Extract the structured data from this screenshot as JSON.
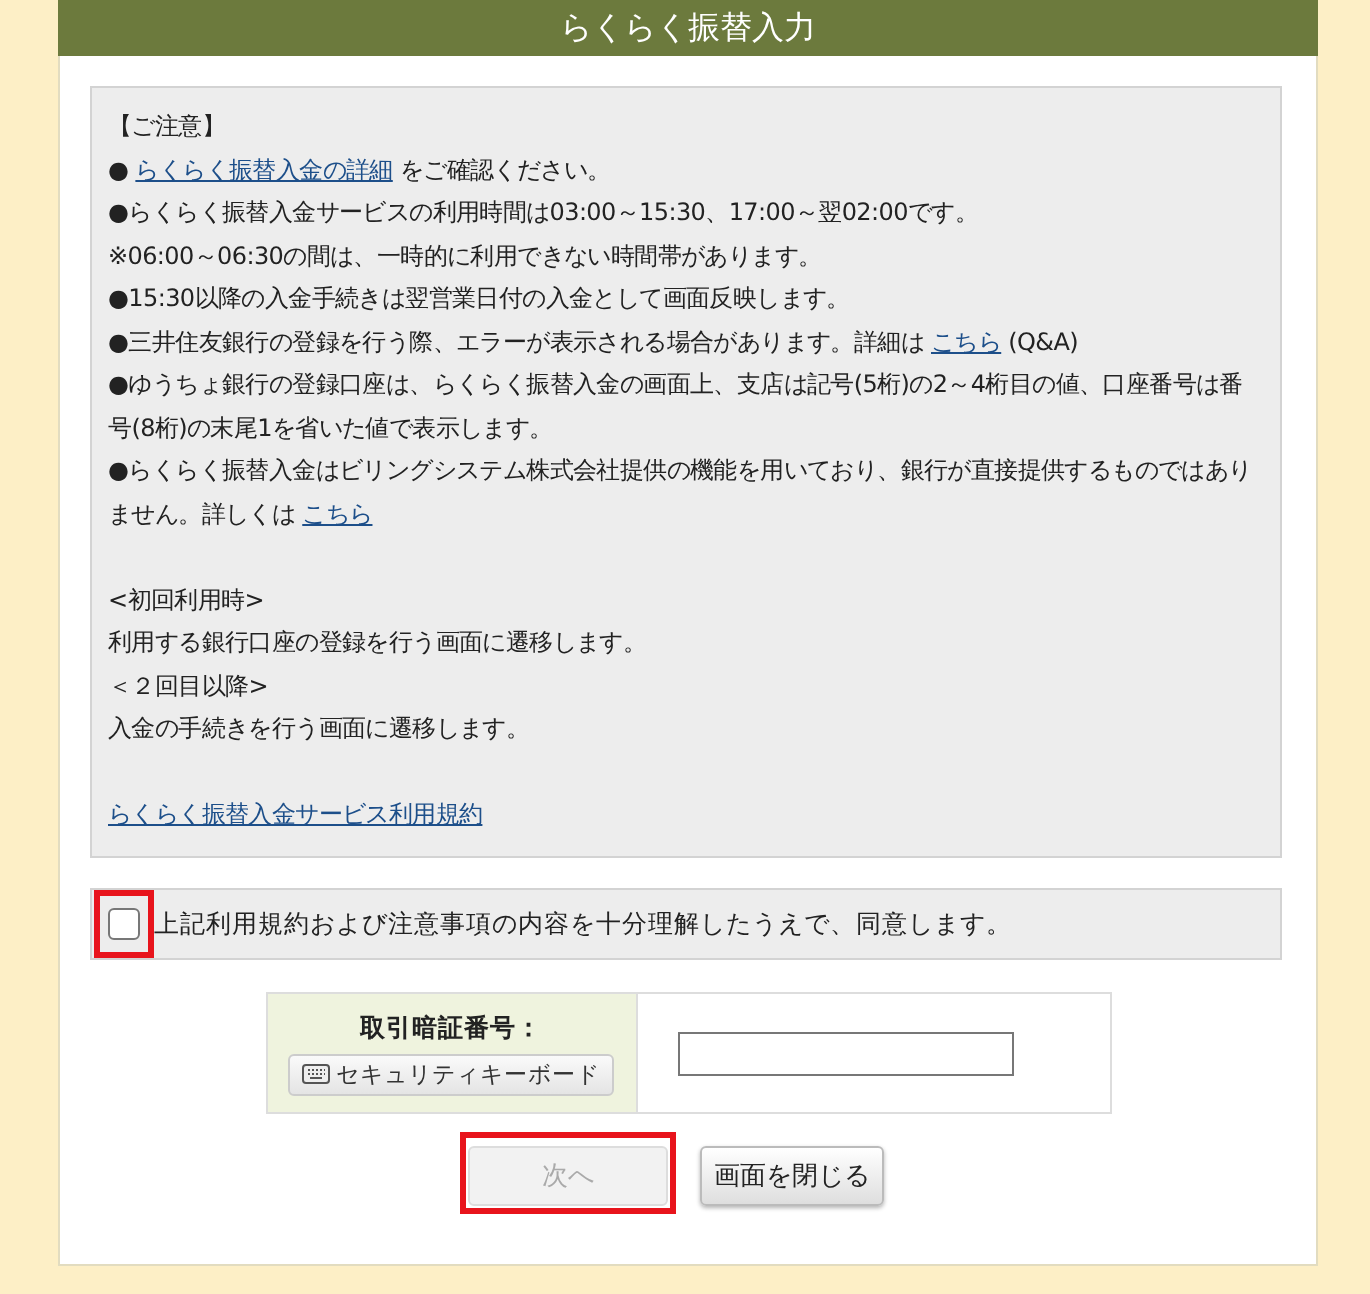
{
  "title": "らくらく振替入力",
  "notice_sections": [
    {
      "lines": [
        [
          {
            "kind": "text",
            "text": "【ご注意】"
          }
        ],
        [
          {
            "kind": "text",
            "text": "●"
          },
          {
            "kind": "link",
            "text": "らくらく振替入金の詳細"
          },
          {
            "kind": "text",
            "text": "をご確認ください。"
          }
        ],
        [
          {
            "kind": "text",
            "text": "●らくらく振替入金サービスの利用時間は03:00～15:30、17:00～翌02:00です。"
          }
        ],
        [
          {
            "kind": "text",
            "text": "※06:00～06:30の間は、一時的に利用できない時間帯があります。"
          }
        ],
        [
          {
            "kind": "text",
            "text": "●15:30以降の入金手続きは翌営業日付の入金として画面反映します。"
          }
        ],
        [
          {
            "kind": "text",
            "text": "●三井住友銀行の登録を行う際、エラーが表示される場合があります。詳細は"
          },
          {
            "kind": "link",
            "text": "こちら"
          },
          {
            "kind": "text",
            "text": "(Q&A)"
          }
        ],
        [
          {
            "kind": "text",
            "text": "●ゆうちょ銀行の登録口座は、らくらく振替入金の画面上、支店は記号(5桁)の2～4桁目の値、口座番号は番号(8桁)の末尾1を省いた値で表示します。"
          }
        ],
        [
          {
            "kind": "text",
            "text": "●らくらく振替入金はビリングシステム株式会社提供の機能を用いており、銀行が直接提供するものではありません。詳しくは"
          },
          {
            "kind": "link",
            "text": "こちら"
          }
        ]
      ]
    },
    {
      "lines": [
        [
          {
            "kind": "text",
            "text": "<初回利用時>"
          }
        ],
        [
          {
            "kind": "text",
            "text": "利用する銀行口座の登録を行う画面に遷移します。"
          }
        ],
        [
          {
            "kind": "text",
            "text": "＜２回目以降>"
          }
        ],
        [
          {
            "kind": "text",
            "text": "入金の手続きを行う画面に遷移します。"
          }
        ]
      ]
    },
    {
      "lines": [
        [
          {
            "kind": "link",
            "text": "らくらく振替入金サービス利用規約"
          }
        ]
      ]
    }
  ],
  "agreement": {
    "label": "上記利用規約および注意事項の内容を十分理解したうえで、同意します。",
    "checked": false,
    "highlighted": true
  },
  "pin": {
    "label": "取引暗証番号：",
    "keyboard_button": "セキュリティキーボード"
  },
  "buttons": [
    {
      "label": "次へ",
      "disabled": true,
      "highlighted": true
    },
    {
      "label": "画面を閉じる",
      "disabled": false,
      "highlighted": false
    }
  ]
}
